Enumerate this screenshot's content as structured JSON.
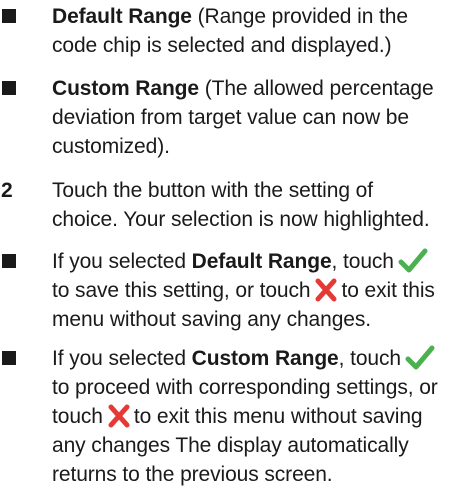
{
  "items": {
    "default_range": {
      "label": "Default Range",
      "desc_l1": " (Range provided in the",
      "desc_l2": "code chip is selected and displayed.)"
    },
    "custom_range": {
      "label": "Custom Range",
      "desc_l1": " (The allowed percentage",
      "desc_l2": "deviation from target value can now be",
      "desc_l3": "customized)."
    }
  },
  "step2": {
    "number": "2",
    "line1": "Touch the button with the setting of",
    "line2": "choice. Your selection is now highlighted."
  },
  "sub_default": {
    "pre": "If you selected ",
    "label": "Default Range",
    "post1": ", touch",
    "line2_pre": "to save this setting, or touch",
    "line2_post": "to exit this",
    "line3": "menu without saving any changes."
  },
  "sub_custom": {
    "pre": "If you selected ",
    "label": "Custom Range",
    "post1": ", touch",
    "line2": "to proceed with corresponding settings, or",
    "line3_pre": "touch",
    "line3_post": "to exit this menu without saving",
    "line4": "any changes The display automatically",
    "line5": "returns to the previous screen."
  },
  "icons": {
    "confirm": "checkmark-icon",
    "cancel": "cross-icon"
  },
  "colors": {
    "text": "#1a1a1a",
    "check": "#4caf50",
    "cross": "#e53935"
  }
}
